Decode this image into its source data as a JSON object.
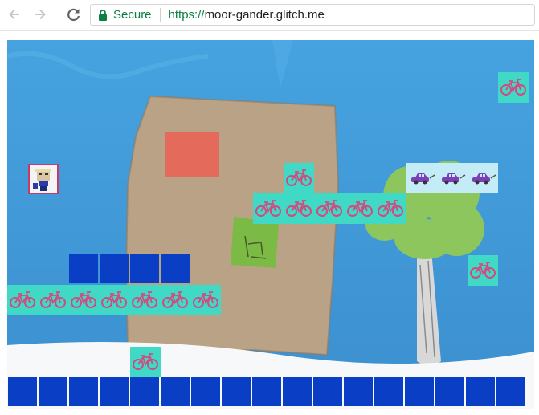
{
  "browser": {
    "secure_label": "Secure",
    "url_scheme": "https://",
    "url_host": "moor-gander.glitch.me",
    "icons": [
      "back-arrow-icon",
      "forward-arrow-icon",
      "reload-icon",
      "lock-icon"
    ],
    "colors": {
      "secure_green": "#0b8043"
    }
  },
  "game": {
    "sprites": {
      "bike_tile": "bicycle-icon",
      "car_tile": "car-icon",
      "ground": "blue-brick",
      "player": "character-portrait"
    },
    "colors": {
      "tile": "#3fd9c6",
      "tile_light": "#c3ecf6",
      "brick": "#0a3fc5",
      "sky": "#3f98d8",
      "bike": "#d24a7f",
      "car": "#7b3fb8"
    }
  }
}
